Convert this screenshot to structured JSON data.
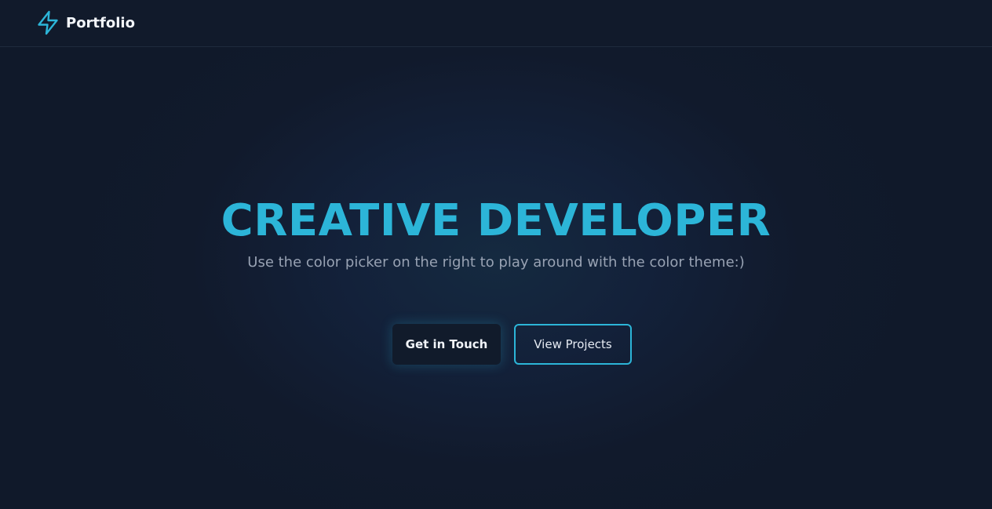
{
  "navbar": {
    "brand_icon": "lightning-bolt-icon",
    "brand_label": "Portfolio"
  },
  "hero": {
    "title": "CREATIVE DEVELOPER",
    "subtitle": "Use the color picker on the right to play around with the color theme:)",
    "primary_button": "Get in Touch",
    "secondary_button": "View Projects"
  },
  "colors": {
    "accent": "#2cb5d8",
    "background": "#111a2b",
    "text": "#f3f6fb",
    "muted_text": "#98a2b3"
  }
}
